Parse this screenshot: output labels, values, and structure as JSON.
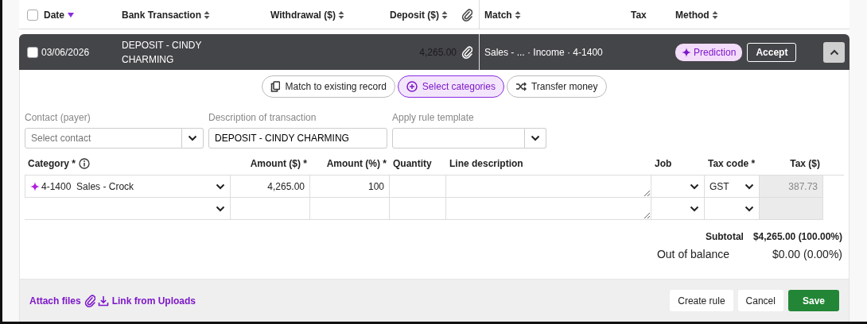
{
  "header": {
    "select_all_checked": false,
    "columns": [
      {
        "label": "Date",
        "sorted_descending": true
      },
      {
        "label": "Bank Transaction",
        "sortable": true
      },
      {
        "label": "Withdrawal ($)",
        "sortable": true
      },
      {
        "label": "Deposit ($)",
        "sortable": true
      },
      {
        "kind": "attachment"
      },
      {
        "label": "Match",
        "sortable": true
      },
      {
        "label": "Tax"
      },
      {
        "label": "Method",
        "sortable": true
      }
    ]
  },
  "transaction": {
    "checked": false,
    "date": "03/06/2026",
    "description": "DEPOSIT - CINDY CHARMING",
    "deposit": "4,265.00",
    "match": "Sales - ... · Income · 4-1400",
    "badge": "Prediction",
    "action": "Accept",
    "expanded": true
  },
  "modes": [
    {
      "label": "Match to existing record",
      "kind": "match",
      "selected": false
    },
    {
      "label": "Select categories",
      "kind": "categories",
      "selected": true
    },
    {
      "label": "Transfer money",
      "kind": "transfer",
      "selected": false
    }
  ],
  "fields": [
    {
      "label": "Contact (payer)",
      "kind": "select",
      "placeholder": "Select contact"
    },
    {
      "label": "Description of transaction",
      "kind": "text",
      "value": "DEPOSIT - CINDY CHARMING"
    },
    {
      "label": "Apply rule template",
      "kind": "select"
    }
  ],
  "lines": {
    "columns": [
      {
        "label": "Category *",
        "info": true
      },
      {
        "label": "Amount ($) *"
      },
      {
        "label": "Amount (%) *"
      },
      {
        "label": "Quantity"
      },
      {
        "label": "Line description"
      },
      {
        "label": "Job"
      },
      {
        "label": "Tax code *"
      },
      {
        "label": "Tax ($)"
      }
    ],
    "rows": [
      {
        "predicted": true,
        "category": "4-1400  Sales - Crock",
        "amount": "4,265.00",
        "percent": "100",
        "tax_code": "GST",
        "tax": "387.73"
      },
      {
        "predicted": false
      }
    ]
  },
  "totals": [
    {
      "kind": "subtotal",
      "label": "Subtotal",
      "value": "$4,265.00 (100.00%)"
    },
    {
      "kind": "balance",
      "label": "Out of balance",
      "value": "$0.00 (0.00%)"
    }
  ],
  "footer": {
    "links": [
      {
        "kind": "attach",
        "label": "Attach files"
      },
      {
        "kind": "upload",
        "label": "Link from Uploads"
      }
    ],
    "buttons": [
      {
        "kind": "secondary",
        "label": "Create rule"
      },
      {
        "kind": "secondary",
        "label": "Cancel"
      },
      {
        "kind": "primary",
        "label": "Save"
      }
    ]
  }
}
